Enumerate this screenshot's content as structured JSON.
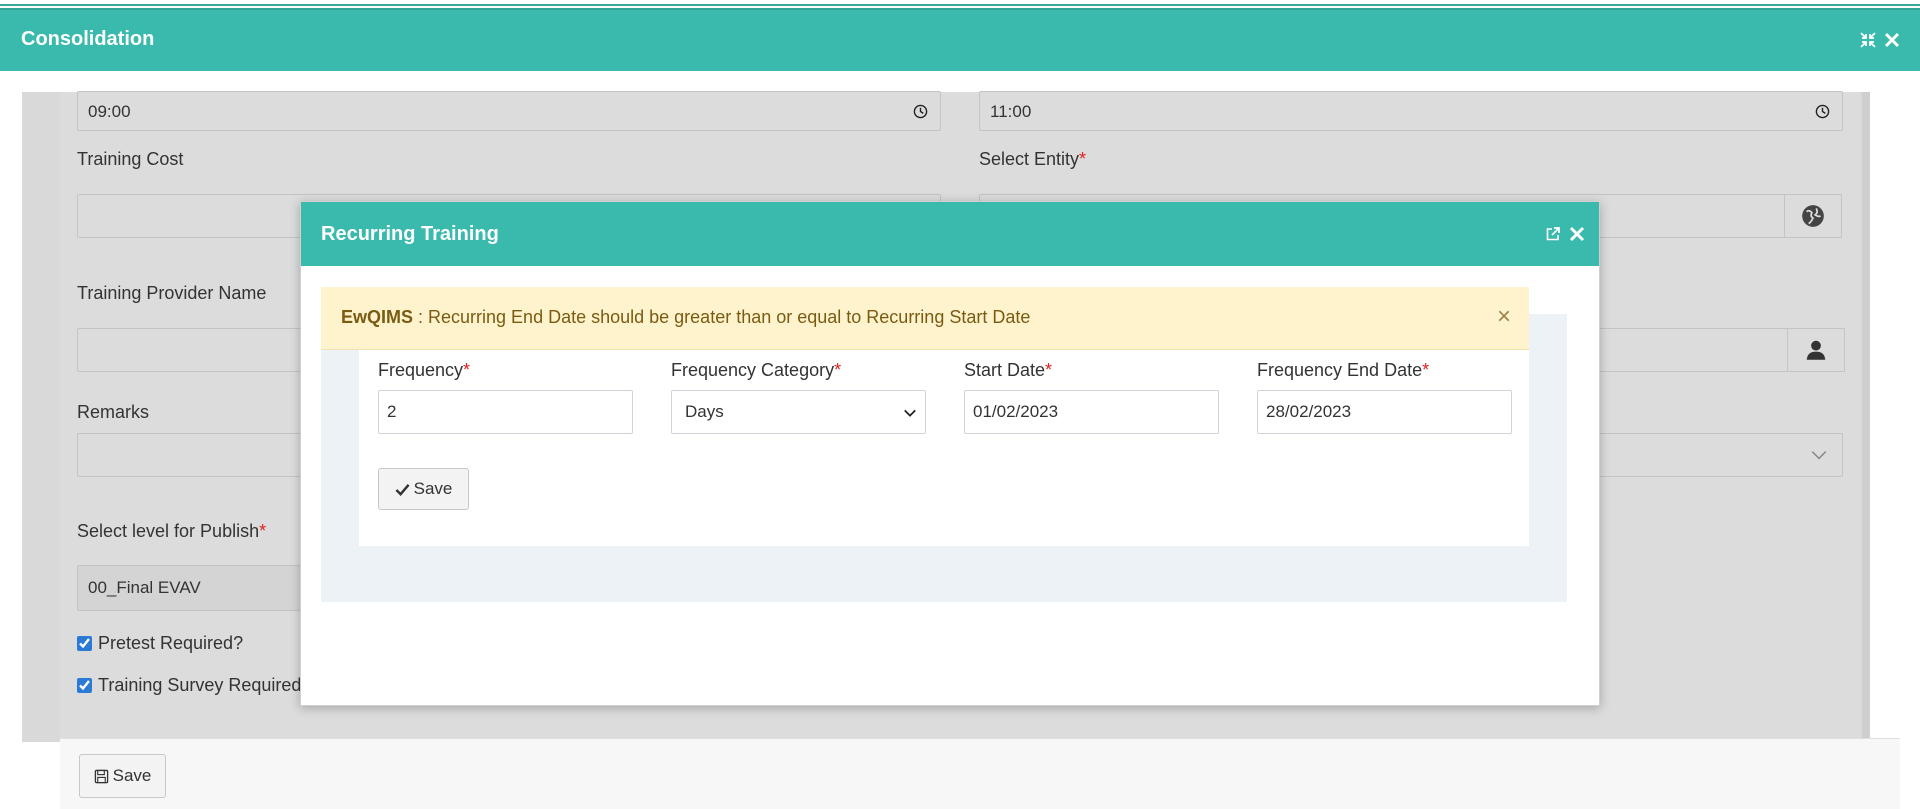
{
  "window": {
    "title": "Consolidation"
  },
  "form": {
    "start_time": "09:00",
    "end_time": "11:00",
    "training_cost_label": "Training Cost",
    "select_entity_label": "Select Entity",
    "provider_label": "Training Provider Name",
    "remarks_label": "Remarks",
    "publish_label": "Select level for Publish",
    "publish_value": "00_Final EVAV",
    "pretest_label": "Pretest Required?",
    "survey_label": "Training Survey Required"
  },
  "footer": {
    "save_label": "Save"
  },
  "dialog": {
    "title": "Recurring Training",
    "alert_app": "EwQIMS",
    "alert_message": " : Recurring End Date should be greater than or equal to Recurring Start Date",
    "alert_close": "×",
    "frequency_label": "Frequency",
    "frequency_value": "2",
    "category_label": "Frequency Category",
    "category_value": "Days",
    "start_label": "Start Date",
    "start_value": "01/02/2023",
    "end_label": "Frequency End Date",
    "end_value": "28/02/2023",
    "save_label": "Save"
  },
  "colors": {
    "header": "#3ab9ad",
    "alert_bg": "#fff3cd",
    "required": "#e02020"
  }
}
